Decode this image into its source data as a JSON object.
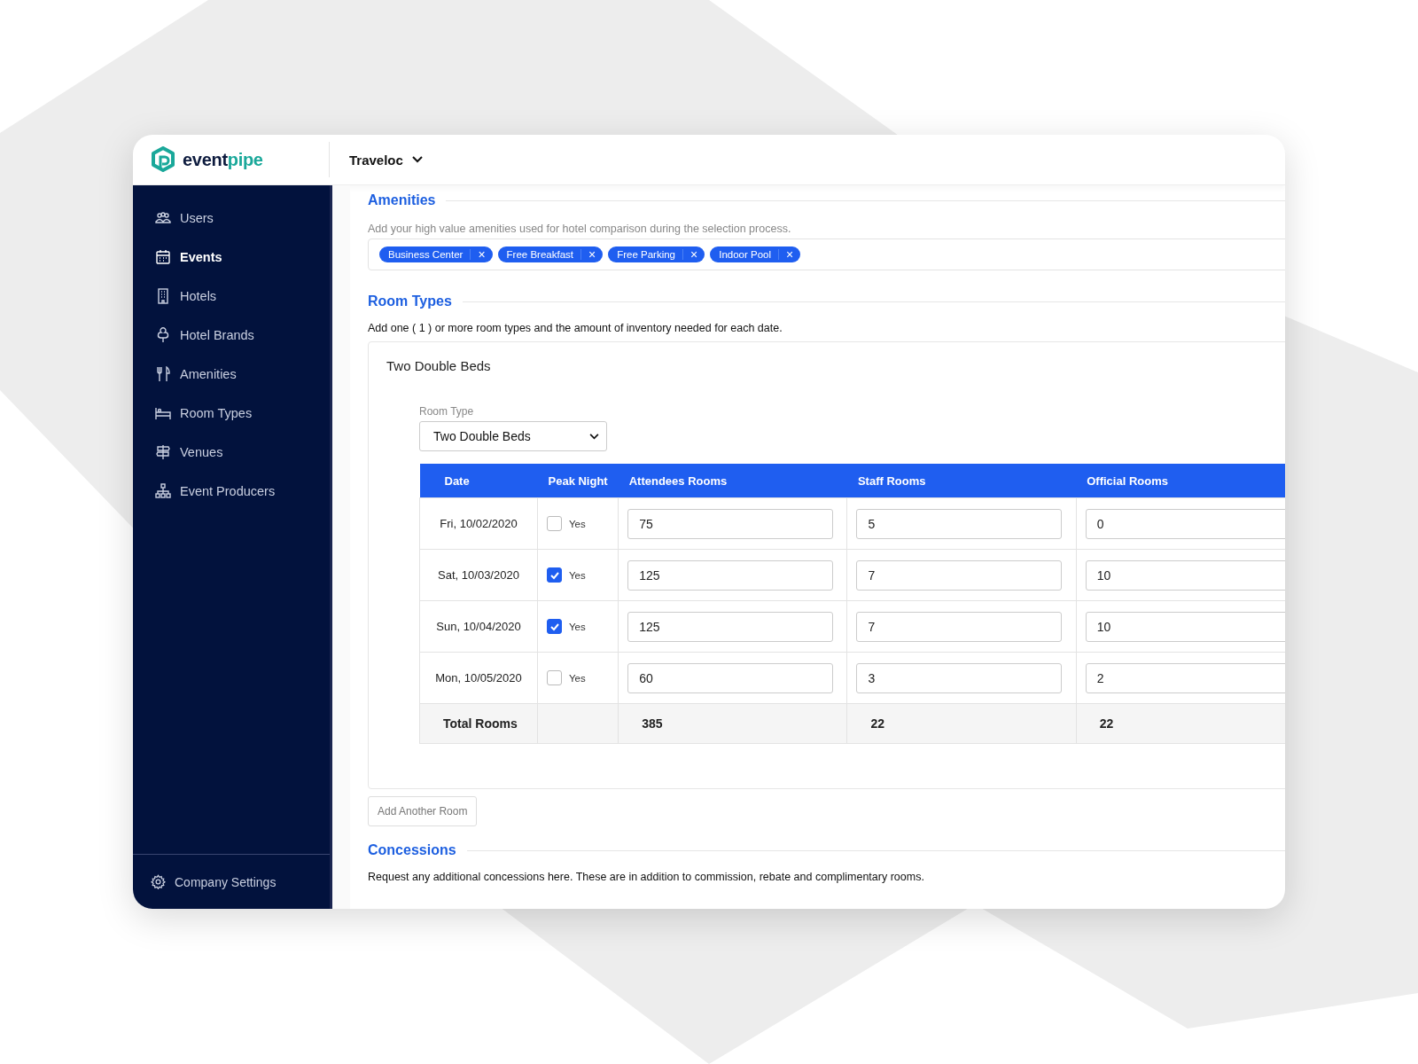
{
  "brand": {
    "first": "event",
    "second": "pipe"
  },
  "account_switcher": {
    "label": "Traveloc"
  },
  "sidebar": {
    "items": [
      {
        "label": "Users",
        "selected": false
      },
      {
        "label": "Events",
        "selected": true
      },
      {
        "label": "Hotels",
        "selected": false
      },
      {
        "label": "Hotel Brands",
        "selected": false
      },
      {
        "label": "Amenities",
        "selected": false
      },
      {
        "label": "Room Types",
        "selected": false
      },
      {
        "label": "Venues",
        "selected": false
      },
      {
        "label": "Event Producers",
        "selected": false
      }
    ],
    "footer": "Company Settings"
  },
  "amenities": {
    "title": "Amenities",
    "description": "Add your high value amenities used for hotel comparison during the selection process.",
    "tags": [
      {
        "label": "Business Center",
        "remove": "×"
      },
      {
        "label": "Free Breakfast",
        "remove": "×"
      },
      {
        "label": "Free Parking",
        "remove": "×"
      },
      {
        "label": "Indoor Pool",
        "remove": "×"
      }
    ]
  },
  "room_types": {
    "title": "Room Types",
    "description": "Add one ( 1 ) or more room types and the amount of inventory needed for each date.",
    "card": {
      "title": "Two Double Beds",
      "field_label": "Room Type",
      "field_value": "Two Double Beds",
      "table": {
        "columns": [
          "Date",
          "Peak Night",
          "Attendees Rooms",
          "Staff Rooms",
          "Official Rooms"
        ],
        "rows": [
          {
            "date": "Fri, 10/02/2020",
            "peak_night": false,
            "peak_label": "Yes",
            "attendees": "75",
            "staff": "5",
            "official": "0"
          },
          {
            "date": "Sat, 10/03/2020",
            "peak_night": true,
            "peak_label": "Yes",
            "attendees": "125",
            "staff": "7",
            "official": "10"
          },
          {
            "date": "Sun, 10/04/2020",
            "peak_night": true,
            "peak_label": "Yes",
            "attendees": "125",
            "staff": "7",
            "official": "10"
          },
          {
            "date": "Mon, 10/05/2020",
            "peak_night": false,
            "peak_label": "Yes",
            "attendees": "60",
            "staff": "3",
            "official": "2"
          }
        ],
        "total": {
          "label": "Total Rooms",
          "attendees": "385",
          "staff": "22",
          "official": "22"
        }
      }
    },
    "add_button": "Add Another Room"
  },
  "concessions": {
    "title": "Concessions",
    "description": "Request any additional concessions here. These are in addition to commission, rebate and complimentary rooms."
  }
}
